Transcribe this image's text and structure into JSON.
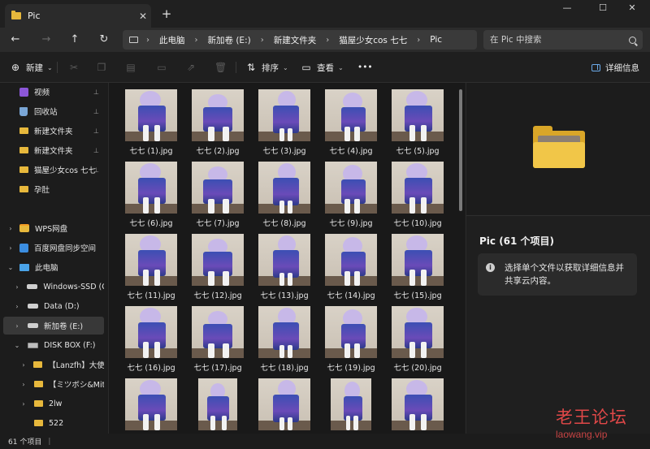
{
  "window": {
    "tab_title": "Pic",
    "tab_close": "✕",
    "new_tab": "+",
    "minimize": "—",
    "maximize": "☐",
    "close": "✕"
  },
  "nav": {
    "back": "←",
    "forward": "→",
    "up": "↑",
    "refresh": "↻",
    "breadcrumbs": [
      "此电脑",
      "新加卷 (E:)",
      "新建文件夹",
      "猫屋少女cos 七七",
      "Pic"
    ],
    "separator": "›",
    "search_placeholder": "在 Pic 中搜索"
  },
  "toolbar": {
    "new_label": "新建",
    "sort_label": "排序",
    "view_label": "查看",
    "more_label": "•••",
    "details_label": "详细信息",
    "caret": "⌄"
  },
  "sidebar": {
    "items": [
      {
        "label": "视频",
        "icon": "video-icon",
        "pinned": true
      },
      {
        "label": "回收站",
        "icon": "recycle-bin-icon",
        "pinned": true
      },
      {
        "label": "新建文件夹",
        "icon": "folder-icon",
        "pinned": true
      },
      {
        "label": "新建文件夹",
        "icon": "folder-icon",
        "pinned": true
      },
      {
        "label": "猫屋少女cos 七七",
        "icon": "folder-icon",
        "pinned": true
      },
      {
        "label": "孕肚",
        "icon": "folder-icon",
        "pinned": false
      },
      {
        "label": "WPS网盘",
        "icon": "wps-cloud-icon",
        "expand": "›"
      },
      {
        "label": "百度网盘同步空间",
        "icon": "baidu-netdisk-icon",
        "expand": "›"
      },
      {
        "label": "此电脑",
        "icon": "this-pc-icon",
        "expand": "⌄"
      },
      {
        "label": "Windows-SSD (C:",
        "icon": "drive-icon",
        "expand": "›"
      },
      {
        "label": "Data (D:)",
        "icon": "drive-icon",
        "expand": "›"
      },
      {
        "label": "新加卷 (E:)",
        "icon": "drive-icon",
        "expand": "›",
        "selected": true
      },
      {
        "label": "DISK BOX (F:)",
        "icon": "usb-drive-icon",
        "expand": "⌄"
      },
      {
        "label": "【Lanzfh】大使3",
        "icon": "folder-icon",
        "expand": "›"
      },
      {
        "label": "【ミツボシ&Mit",
        "icon": "folder-icon",
        "expand": "›"
      },
      {
        "label": "2lw",
        "icon": "folder-icon",
        "expand": "›"
      },
      {
        "label": "522",
        "icon": "folder-icon",
        "expand": ""
      }
    ],
    "pin_glyph": "📌"
  },
  "files": [
    "七七 (1).jpg",
    "七七 (2).jpg",
    "七七 (3).jpg",
    "七七 (4).jpg",
    "七七 (5).jpg",
    "七七 (6).jpg",
    "七七 (7).jpg",
    "七七 (8).jpg",
    "七七 (9).jpg",
    "七七 (10).jpg",
    "七七 (11).jpg",
    "七七 (12).jpg",
    "七七 (13).jpg",
    "七七 (14).jpg",
    "七七 (15).jpg",
    "七七 (16).jpg",
    "七七 (17).jpg",
    "七七 (18).jpg",
    "七七 (19).jpg",
    "七七 (20).jpg",
    "",
    "",
    "",
    "",
    ""
  ],
  "details": {
    "title": "Pic (61 个项目)",
    "info_icon": "i",
    "info_text": "选择单个文件以获取详细信息并共享云内容。"
  },
  "status": {
    "count": "61 个项目",
    "bar": "|"
  },
  "watermark": {
    "cn": "老王论坛",
    "en": "laowang.vip"
  },
  "colors": {
    "accent": "#6aa9e8",
    "folder": "#e7b83c",
    "watermark": "#e04848"
  }
}
